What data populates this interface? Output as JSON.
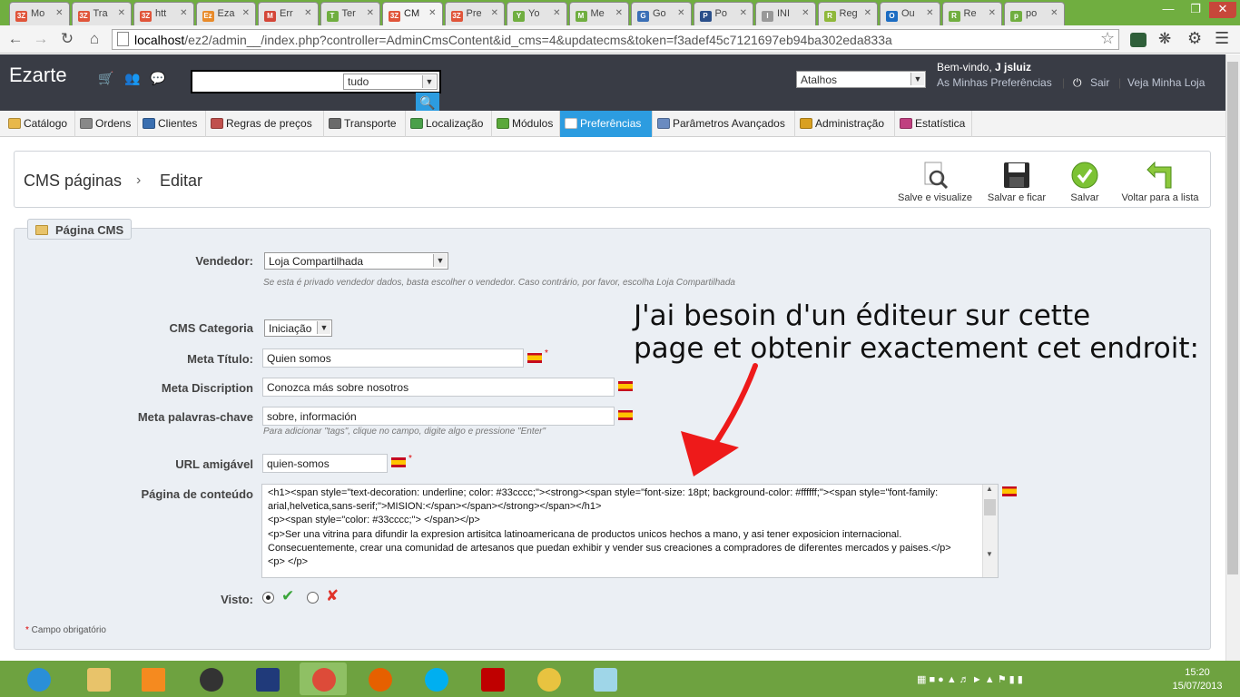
{
  "browser": {
    "tabs": [
      {
        "label": "Mo",
        "fav": "3Z",
        "color": "#e0553a"
      },
      {
        "label": "Tra",
        "fav": "3Z",
        "color": "#e0553a"
      },
      {
        "label": "htt",
        "fav": "3Z",
        "color": "#e0553a"
      },
      {
        "label": "Eza",
        "fav": "Ez",
        "color": "#e88a2a"
      },
      {
        "label": "Err",
        "fav": "M",
        "color": "#d44638"
      },
      {
        "label": "Ter",
        "fav": "T",
        "color": "#70ae40"
      },
      {
        "label": "CM",
        "fav": "3Z",
        "color": "#e0553a"
      },
      {
        "label": "Pre",
        "fav": "3Z",
        "color": "#e0553a"
      },
      {
        "label": "Yo",
        "fav": "Y",
        "color": "#70ae40"
      },
      {
        "label": "Me",
        "fav": "M",
        "color": "#70ae40"
      },
      {
        "label": "Go",
        "fav": "G",
        "color": "#3b6fb6"
      },
      {
        "label": "Po",
        "fav": "P",
        "color": "#2a4f8a"
      },
      {
        "label": "INI",
        "fav": "I",
        "color": "#999999"
      },
      {
        "label": "Reg",
        "fav": "R",
        "color": "#8fb83a"
      },
      {
        "label": "Ou",
        "fav": "O",
        "color": "#1c6cc2"
      },
      {
        "label": "Re",
        "fav": "R",
        "color": "#70ae40"
      },
      {
        "label": "po",
        "fav": "p",
        "color": "#70ae40"
      }
    ],
    "url_host": "localhost",
    "url_path": "/ez2/admin__/index.php?controller=AdminCmsContent&id_cms=4&updatecms&token=f3adef45c7121697eb94ba302eda833a"
  },
  "header": {
    "logo": "Ezarte",
    "search_scope": "tudo",
    "shortcuts_label": "Atalhos",
    "welcome_prefix": "Bem-vindo, ",
    "welcome_user": "J jsluiz",
    "preferences_link": "As Minhas Preferências",
    "logout_link": "Sair",
    "view_shop_link": "Veja Minha Loja"
  },
  "menu": [
    {
      "label": "Catálogo",
      "color": "#e8b84a"
    },
    {
      "label": "Ordens",
      "color": "#888888"
    },
    {
      "label": "Clientes",
      "color": "#3a6fb0"
    },
    {
      "label": "Regras de preços",
      "color": "#c0504d"
    },
    {
      "label": "Transporte",
      "color": "#6b6b6b"
    },
    {
      "label": "Localização",
      "color": "#4aa04a"
    },
    {
      "label": "Módulos",
      "color": "#5aa83a"
    },
    {
      "label": "Preferências",
      "color": "#ffffff",
      "active": true
    },
    {
      "label": "Parâmetros Avançados",
      "color": "#6a8bc0"
    },
    {
      "label": "Administração",
      "color": "#d9a020"
    },
    {
      "label": "Estatística",
      "color": "#c04080"
    }
  ],
  "toolbar": {
    "breadcrumb_parent": "CMS páginas",
    "breadcrumb_sep": "›",
    "breadcrumb_current": "Editar",
    "buttons": [
      {
        "label": "Salve e visualize",
        "icon": "preview-icon"
      },
      {
        "label": "Salvar e ficar",
        "icon": "floppy-icon"
      },
      {
        "label": "Salvar",
        "icon": "check-icon"
      },
      {
        "label": "Voltar para a lista",
        "icon": "back-arrow-icon"
      }
    ]
  },
  "form": {
    "legend": "Página CMS",
    "vendor_label": "Vendedor:",
    "vendor_value": "Loja Compartilhada",
    "vendor_help": "Se esta é privado vendedor dados, basta escolher o vendedor. Caso contrário, por favor, escolha Loja Compartilhada",
    "category_label": "CMS Categoria",
    "category_value": "Iniciação",
    "meta_title_label": "Meta Título:",
    "meta_title_value": "Quien somos",
    "meta_desc_label": "Meta Discription",
    "meta_desc_value": "Conozca más sobre nosotros",
    "meta_keywords_label": "Meta palavras-chave",
    "meta_keywords_value": "sobre, información",
    "meta_keywords_help": "Para adicionar \"tags\", clique no campo, digite algo e pressione \"Enter\"",
    "url_label": "URL amigável",
    "url_value": "quien-somos",
    "content_label": "Página de conteúdo",
    "content_lines": [
      "<h1><span style=\"text-decoration: underline; color: #33cccc;\"><strong><span style=\"font-size: 18pt; background-color: #ffffff;\"><span style=\"font-family: arial,helvetica,sans-serif;\">MISION:</span></span></strong></span></h1>",
      "<p><span style=\"color: #33cccc;\"> </span></p>",
      "<p>Ser una vitrina para difundir la expresion artisitca latinoamericana de productos unicos hechos a mano, y asi tener exposicion internacional. Consecuentemente, crear una comunidad de artesanos que puedan exhibir y vender sus creaciones a compradores de diferentes mercados y paises.</p>",
      "<p> </p>"
    ],
    "visible_label": "Visto:",
    "required_note": "Campo obrigatório"
  },
  "annotation": {
    "line1": "J'ai besoin d'un éditeur sur cette",
    "line2": "page et obtenir exactement cet endroit:"
  },
  "taskbar": {
    "time": "15:20",
    "date": "15/07/2013"
  }
}
